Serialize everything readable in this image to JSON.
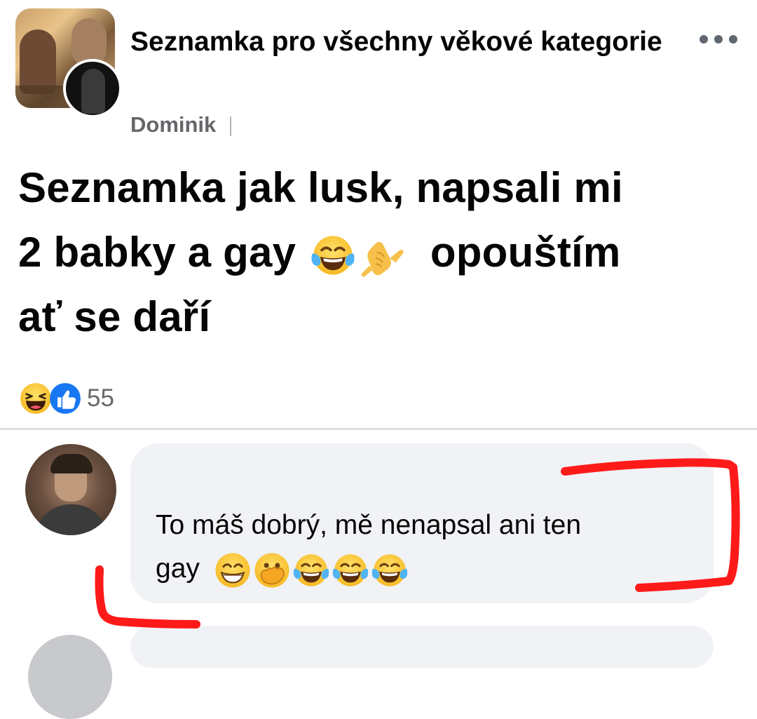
{
  "post": {
    "group_name": "Seznamka pro všechny věkové kategorie",
    "author": "Dominik",
    "text_line1": "Seznamka jak lusk, napsali mi",
    "text_line2_a": "2 babky a gay",
    "text_line2_b": "opouštím",
    "text_line3": "ať se daří",
    "inline_emojis": [
      "tears-of-joy-emoji",
      "call-me-hand-emoji"
    ]
  },
  "reactions": {
    "icons": [
      "haha-reaction-icon",
      "like-reaction-icon"
    ],
    "count": "55"
  },
  "comment": {
    "text_line1": "To máš dobrý, mě nenapsal ani ten",
    "text_line2": "gay",
    "emojis": [
      "grinning-emoji",
      "face-with-hand-over-mouth-emoji",
      "tears-of-joy-emoji",
      "tears-of-joy-emoji",
      "tears-of-joy-emoji"
    ]
  },
  "colors": {
    "annotation_red": "#ff1a1a",
    "bubble_bg": "#f0f2f5",
    "secondary_text": "#65676b",
    "like_blue": "#1877f2"
  }
}
